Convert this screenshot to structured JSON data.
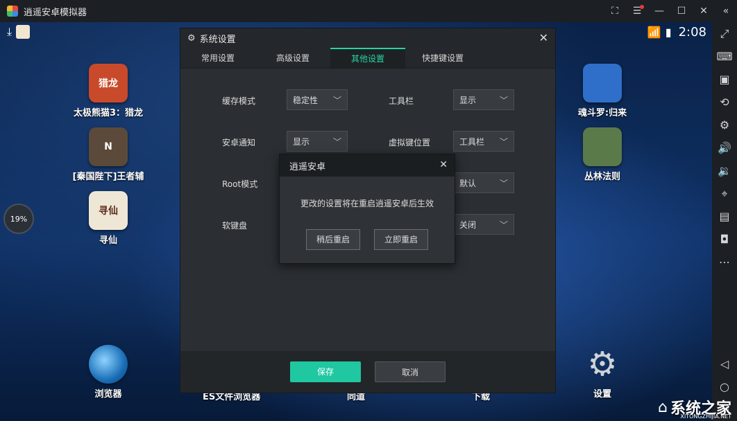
{
  "titlebar": {
    "title": "逍遥安卓模拟器"
  },
  "status": {
    "time": "2:08"
  },
  "progress": {
    "label": "19%",
    "fraction": 0.19
  },
  "apps_left": [
    {
      "label": "太极熊猫3：猎龙",
      "badge": "猎龙",
      "color": "#c84a2a"
    },
    {
      "label": "[秦国陛下]王者辅",
      "badge": "N",
      "color": "#5b4a3a"
    },
    {
      "label": "寻仙",
      "badge": "寻仙",
      "color": "#efe7d6"
    }
  ],
  "apps_right": [
    {
      "label": "魂斗罗:归来",
      "badge": "",
      "color": "#2f6fc9"
    },
    {
      "label": "丛林法则",
      "badge": "",
      "color": "#5a7a4a"
    },
    {
      "label": "设置",
      "badge": "",
      "color": "#cfd3d8"
    }
  ],
  "app_bottom_left": {
    "label": "浏览器"
  },
  "bottom_cut_labels": [
    "ES文件浏览器",
    "同道",
    "下载"
  ],
  "settings": {
    "title": "系统设置",
    "tabs": [
      "常用设置",
      "高级设置",
      "其他设置",
      "快捷键设置"
    ],
    "active_tab": 2,
    "rows": {
      "cache_mode_label": "缓存模式",
      "cache_mode_value": "稳定性",
      "toolbar_label": "工具栏",
      "toolbar_value": "显示",
      "android_notify_label": "安卓通知",
      "android_notify_value": "显示",
      "virtual_key_label": "虚拟键位置",
      "virtual_key_value": "工具栏",
      "root_label": "Root模式",
      "root_value": "默认",
      "soft_keyboard_label": "软键盘",
      "soft_keyboard_value": "关闭"
    },
    "save": "保存",
    "cancel": "取消"
  },
  "dialog": {
    "title": "逍遥安卓",
    "message": "更改的设置将在重启逍遥安卓后生效",
    "later": "稍后重启",
    "now": "立即重启"
  },
  "watermark": {
    "main": "系统之家",
    "sub": "XITONGZHIJIA.NET"
  },
  "colors": {
    "accent": "#1fc8a0",
    "close_dot": "#e43b3b"
  }
}
